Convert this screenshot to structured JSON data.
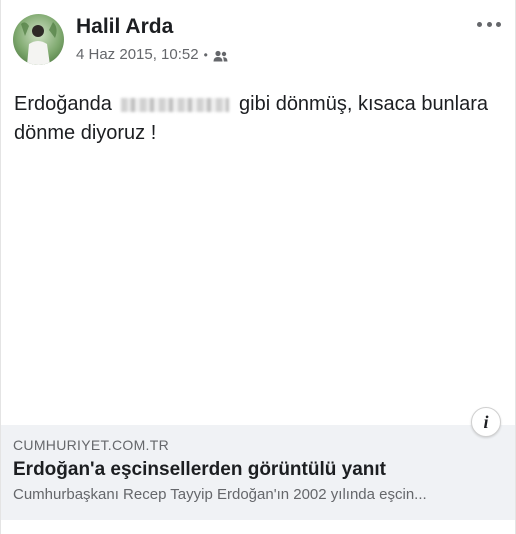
{
  "post": {
    "author": "Halil Arda",
    "timestamp": "4 Haz 2015, 10:52",
    "separator": "•",
    "audience_icon": "friends-icon",
    "more_icon": "more-horizontal-icon",
    "text_before": "Erdoğanda",
    "text_after": "gibi dönmüş, kısaca bunlara dönme diyoruz !"
  },
  "link_card": {
    "domain": "CUMHURIYET.COM.TR",
    "title": "Erdoğan'a eşcinsellerden görüntülü yanıt",
    "description": "Cumhurbaşkanı Recep Tayyip Erdoğan'ın 2002 yılında eşcin...",
    "info_icon": "info-icon",
    "info_label": "i"
  },
  "colors": {
    "text_primary": "#1c1e21",
    "text_secondary": "#65676b",
    "card_background": "#f0f2f5"
  }
}
